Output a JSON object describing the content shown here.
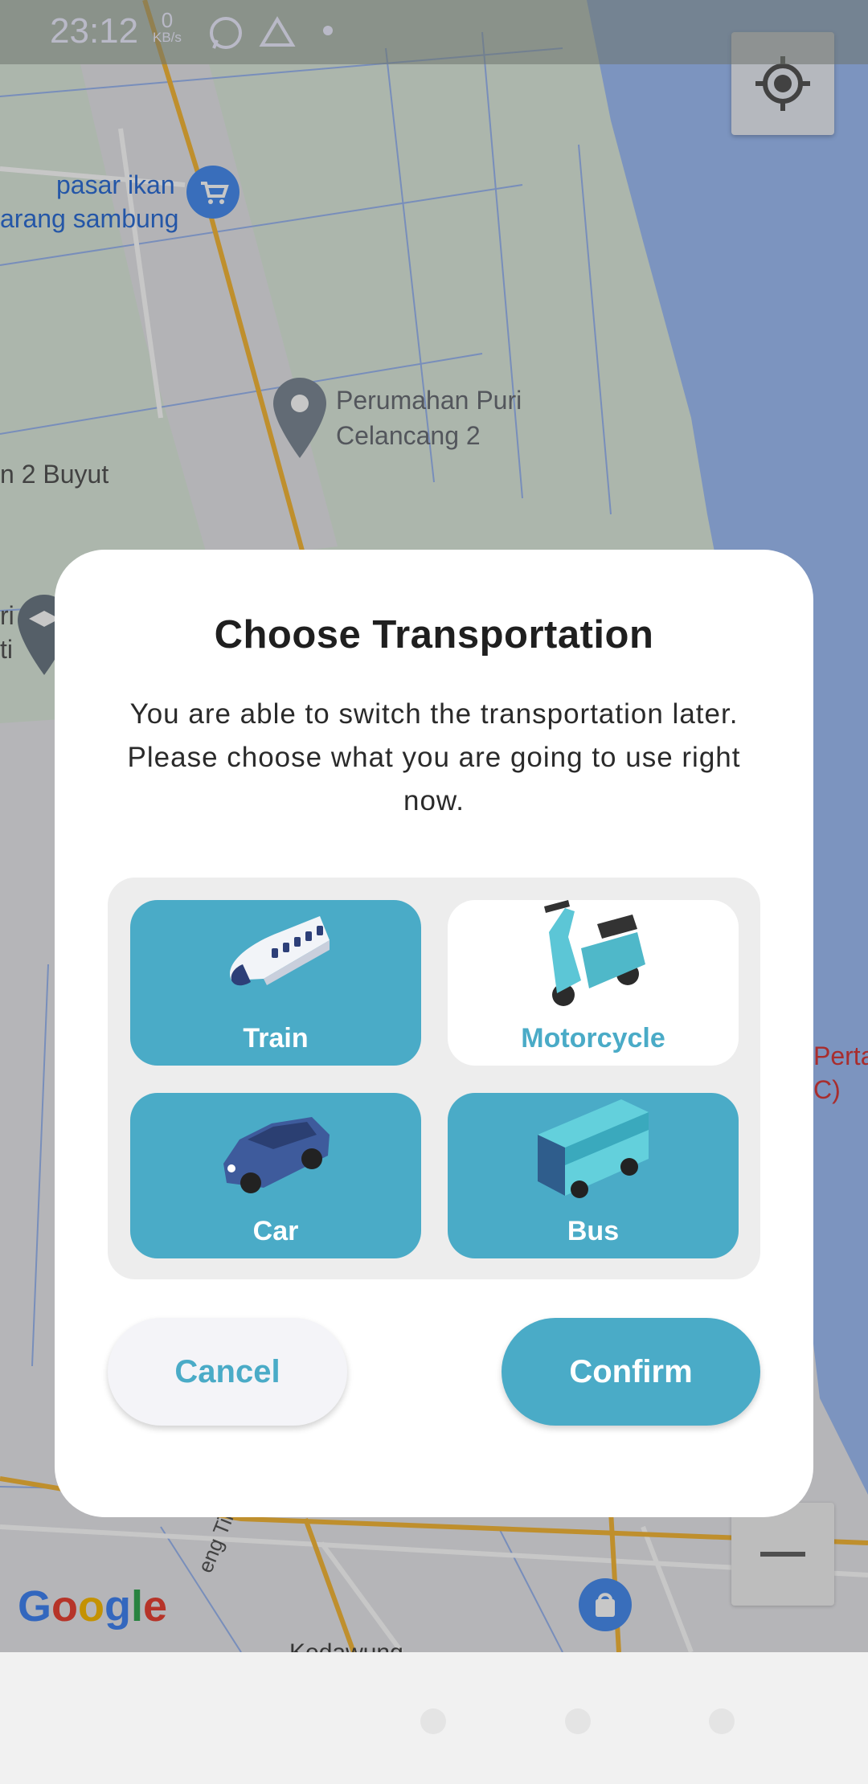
{
  "status_bar": {
    "time": "23:12",
    "net_speed_value": "0",
    "net_speed_unit": "KB/s",
    "icons": [
      "whatsapp-icon",
      "drive-icon",
      "dot-icon"
    ]
  },
  "map": {
    "labels": {
      "pasar_ikan_1": "pasar ikan",
      "pasar_ikan_2": "arang sambung",
      "perumahan_1": "Perumahan Puri",
      "perumahan_2": "Celancang 2",
      "buyut": "n 2 Buyut",
      "school_1": "ri",
      "school_2": "ti",
      "perta_1": "Perta",
      "perta_2": "C)",
      "tirtayasa": "eng Tirtayasa",
      "kedawung": "Kedawung"
    },
    "google_logo": "Google",
    "colors": {
      "land": "#dde9dd",
      "water": "#9fbef5",
      "road_major": "#f5b83a"
    }
  },
  "dialog": {
    "title": "Choose Transportation",
    "message": "You are able to switch the transportation later. Please choose what you are going to use right now.",
    "options": [
      {
        "label": "Train",
        "icon": "train-icon"
      },
      {
        "label": "Motorcycle",
        "icon": "scooter-icon"
      },
      {
        "label": "Car",
        "icon": "car-icon"
      },
      {
        "label": "Bus",
        "icon": "bus-icon"
      }
    ],
    "cancel_label": "Cancel",
    "confirm_label": "Confirm",
    "accent_color": "#4aabc7"
  }
}
